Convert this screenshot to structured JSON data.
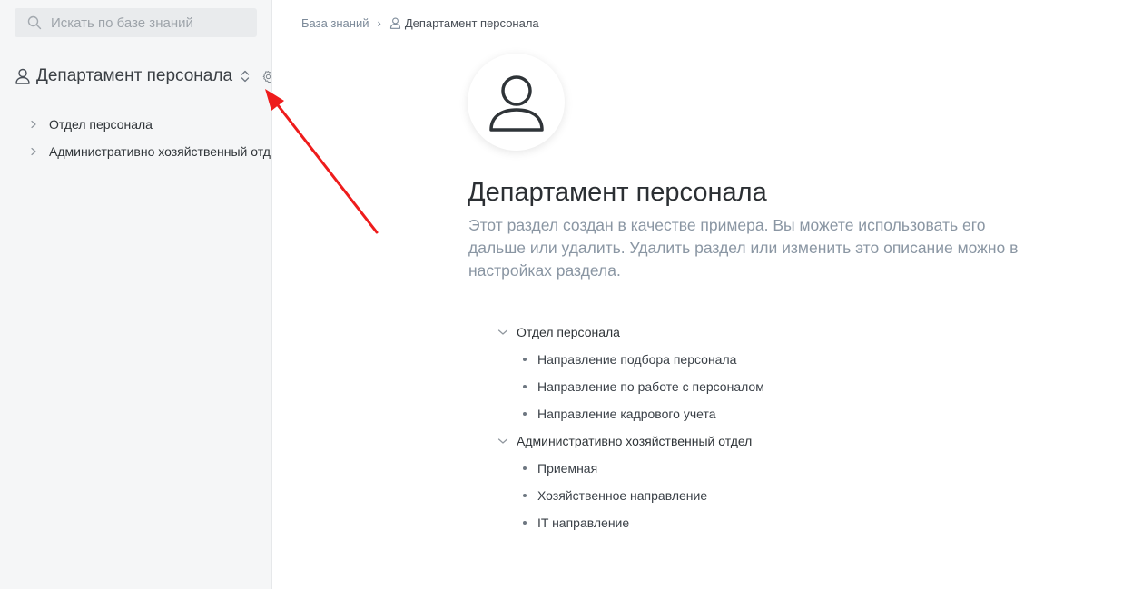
{
  "sidebar": {
    "search": {
      "placeholder": "Искать по базе знаний",
      "value": ""
    },
    "space": {
      "title": "Департамент персонала"
    },
    "tree": [
      {
        "label": "Отдел персонала"
      },
      {
        "label": "Административно хозяйственный отд"
      }
    ]
  },
  "breadcrumb": {
    "root": "База знаний",
    "separator": "›",
    "current": "Департамент персонала"
  },
  "page": {
    "title": "Департамент персонала",
    "description": "Этот раздел создан в качестве примера. Вы можете использовать его дальше или удалить. Удалить раздел или изменить это описание можно в настройках раздела."
  },
  "content_tree": [
    {
      "label": "Отдел персонала",
      "children": [
        "Направление подбора персонала",
        "Направление по работе с персоналом",
        "Направление кадрового учета"
      ]
    },
    {
      "label": "Административно хозяйственный отдел",
      "children": [
        "Приемная",
        "Хозяйственное направление",
        "IT направление"
      ]
    }
  ],
  "colors": {
    "sidebar_bg": "#f5f6f7",
    "search_bg": "#e9ebed",
    "muted_text": "#8a96a3",
    "annotation_arrow": "#ee1c1c"
  },
  "icons": {
    "search": "search-icon",
    "user": "user-icon",
    "switch": "switch-icon",
    "settings": "gear-icon",
    "chevron_right": "chevron-right-icon",
    "chevron_down": "chevron-down-icon",
    "arrow": "annotation-arrow"
  }
}
